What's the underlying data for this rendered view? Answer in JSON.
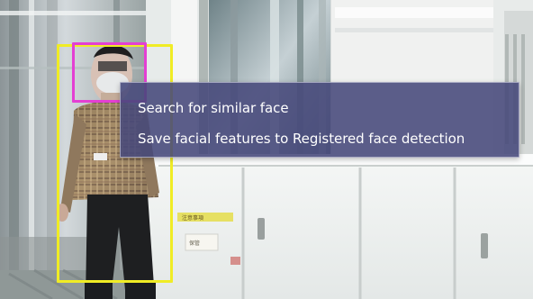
{
  "viewer": {
    "label": "camera-frame",
    "overlay_colors": {
      "person_box": "#f0ec25",
      "face_box": "#e43fd3",
      "menu_background": "#46487a",
      "menu_text": "#ffffff"
    }
  },
  "context_menu": {
    "items": [
      {
        "label": "Search for similar face"
      },
      {
        "label": "Save facial features to Registered face detection"
      }
    ]
  }
}
